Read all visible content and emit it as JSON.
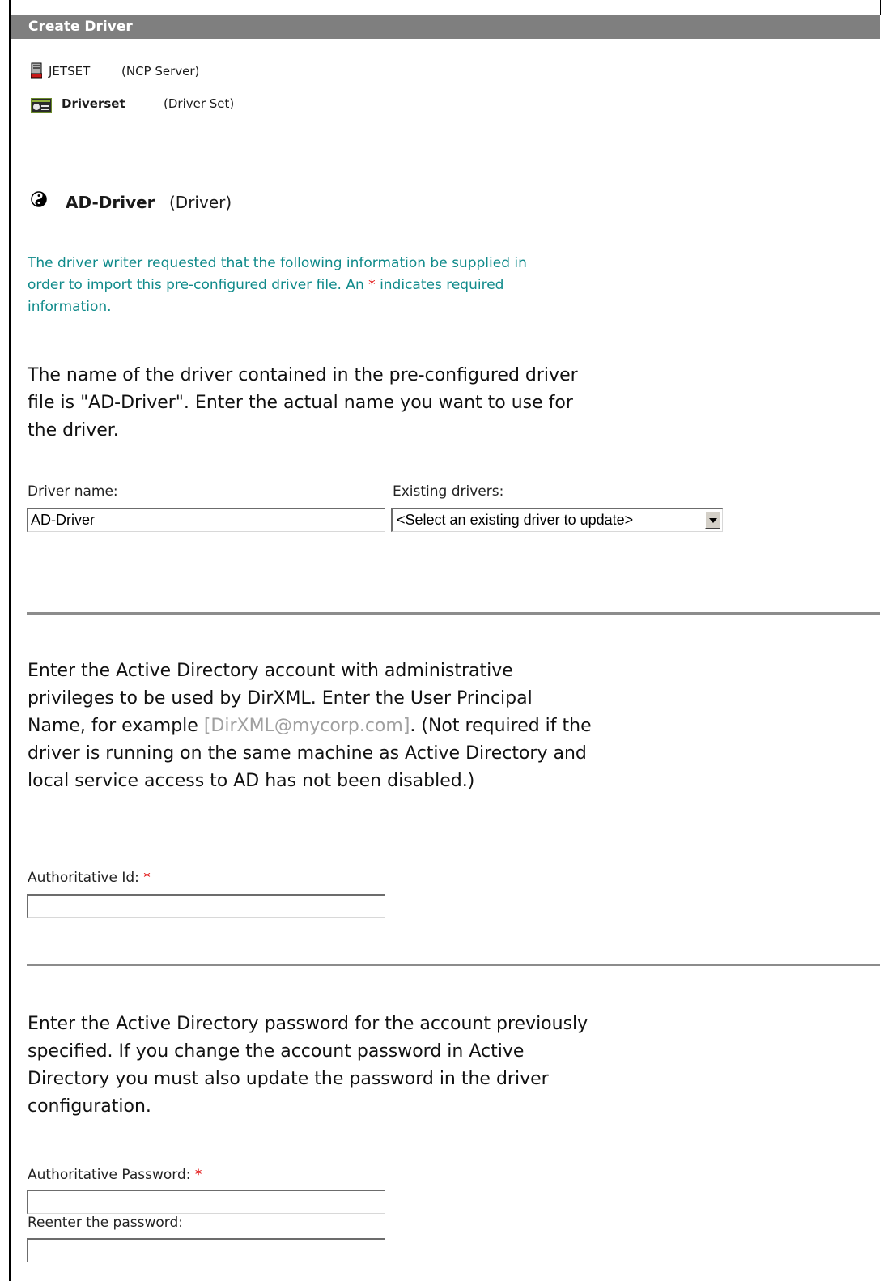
{
  "header": {
    "title": "Create Driver"
  },
  "context": {
    "server": {
      "name": "JETSET",
      "type": "(NCP Server)",
      "icon": "server-icon"
    },
    "driverset": {
      "name": "Driverset",
      "type": "(Driver Set)",
      "icon": "driver-set-icon"
    },
    "driver": {
      "name": "AD-Driver",
      "type": "(Driver)",
      "icon": "yin-yang-driver-icon"
    }
  },
  "intro": {
    "text": "The driver writer requested that the following information be supplied in order to import this pre-configured driver file. An",
    "required_marker": "*",
    "text_after": "indicates required information."
  },
  "driver_section": {
    "description": "The name of the driver contained in the pre-configured driver file is \"AD-Driver\".  Enter the actual name you want to use for the driver.",
    "name_label": "Driver name:",
    "name_value": "AD-Driver",
    "existing_label": "Existing drivers:",
    "existing_selected": "<Select an existing driver to update>"
  },
  "account_section": {
    "description_before": "Enter the Active Directory account with administrative privileges to be used by DirXML. Enter the User Principal Name, for example",
    "example": "[DirXML@mycorp.com]",
    "description_after": ". (Not required if the driver is running on the same machine as Active Directory and local service access to AD has not been disabled.)",
    "id_label": "Authoritative Id:",
    "required_marker": "*",
    "id_value": ""
  },
  "password_section": {
    "description": "Enter the Active Directory password for the account previously specified. If you change the account password in Active Directory you must also update the password in the driver configuration.",
    "password_label": "Authoritative Password:",
    "required_marker": "*",
    "password_value": "",
    "reenter_label": "Reenter the password:",
    "reenter_value": ""
  },
  "colors": {
    "header_bg": "#7f7f7f",
    "info_text": "#0f8a8a",
    "required": "#e00000"
  }
}
